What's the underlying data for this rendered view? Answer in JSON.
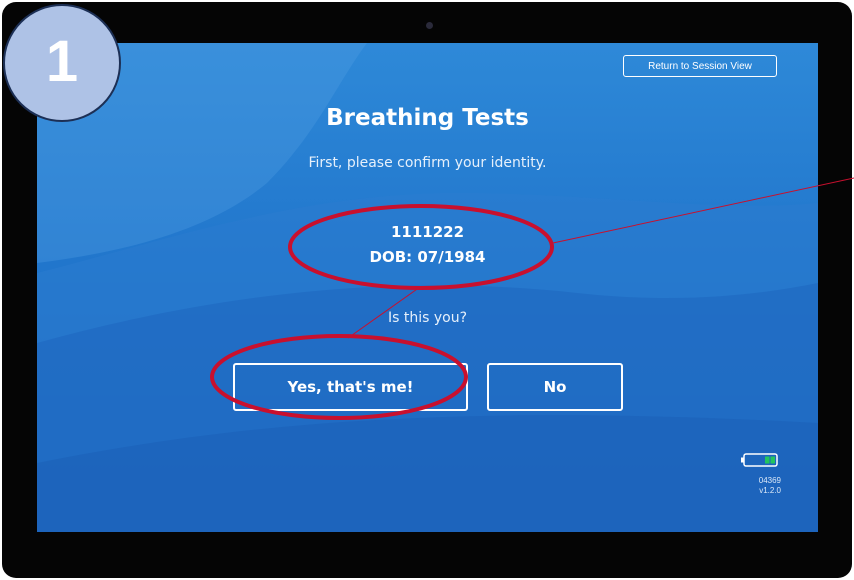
{
  "step_badge": "1",
  "screen": {
    "return_button": "Return to Session View",
    "title": "Breathing Tests",
    "subtitle": "First, please confirm your identity.",
    "patient_id": "1111222",
    "dob": "DOB: 07/1984",
    "question": "Is this you?",
    "yes_button": "Yes, that's me!",
    "no_button": "No",
    "battery_icon": "battery-icon",
    "serial": "04369",
    "version": "v1.2.0"
  },
  "colors": {
    "screen_blue": "#2176cc",
    "annotation_red": "#c8102e",
    "battery_green": "#22c55e",
    "badge_fill": "#aec2e6",
    "badge_border": "#1c2f55"
  }
}
